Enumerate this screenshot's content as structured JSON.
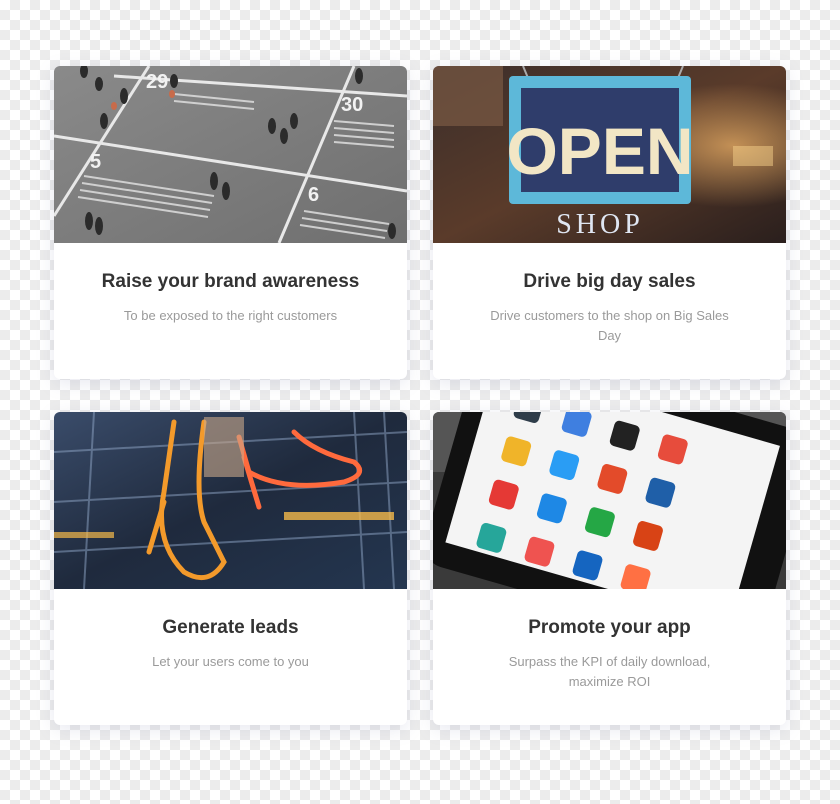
{
  "cards": [
    {
      "title": "Raise your brand awareness",
      "description": "To be exposed to the right customers",
      "numbers": [
        "29",
        "30",
        "5",
        "6"
      ]
    },
    {
      "title": "Drive big day sales",
      "description": "Drive customers  to the shop on Big Sales Day",
      "sign_text": "OPEN",
      "sign_sub": "SHOP"
    },
    {
      "title": "Generate leads",
      "description": "Let your users come to you"
    },
    {
      "title": "Promote your app",
      "description": "Surpass the KPI of daily download, maximize ROI"
    }
  ]
}
